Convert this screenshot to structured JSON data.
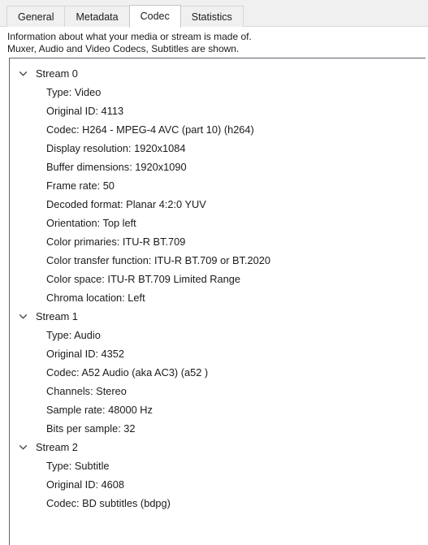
{
  "tabs": [
    {
      "label": "General",
      "active": false
    },
    {
      "label": "Metadata",
      "active": false
    },
    {
      "label": "Codec",
      "active": true
    },
    {
      "label": "Statistics",
      "active": false
    }
  ],
  "description": {
    "line1": "Information about what your media or stream is made of.",
    "line2": "Muxer, Audio and Video Codecs, Subtitles are shown."
  },
  "icons": {
    "expanded_chevron": "chevron-down-icon"
  },
  "colors": {
    "tabstrip_background": "#f0f0f0",
    "active_tab_background": "#ffffff",
    "panel_border": "#5b646b",
    "text": "#1b1b1b"
  },
  "streams": [
    {
      "title": "Stream 0",
      "expanded": true,
      "properties": [
        "Type: Video",
        "Original ID: 4113",
        "Codec: H264 - MPEG-4 AVC (part 10) (h264)",
        "Display resolution: 1920x1084",
        "Buffer dimensions: 1920x1090",
        "Frame rate: 50",
        "Decoded format: Planar 4:2:0 YUV",
        "Orientation: Top left",
        "Color primaries: ITU-R BT.709",
        "Color transfer function: ITU-R BT.709 or BT.2020",
        "Color space: ITU-R BT.709 Limited Range",
        "Chroma location: Left"
      ]
    },
    {
      "title": "Stream 1",
      "expanded": true,
      "properties": [
        "Type: Audio",
        "Original ID: 4352",
        "Codec: A52 Audio (aka AC3) (a52 )",
        "Channels: Stereo",
        "Sample rate: 48000 Hz",
        "Bits per sample: 32"
      ]
    },
    {
      "title": "Stream 2",
      "expanded": true,
      "properties": [
        "Type: Subtitle",
        "Original ID: 4608",
        "Codec: BD subtitles (bdpg)"
      ]
    }
  ]
}
